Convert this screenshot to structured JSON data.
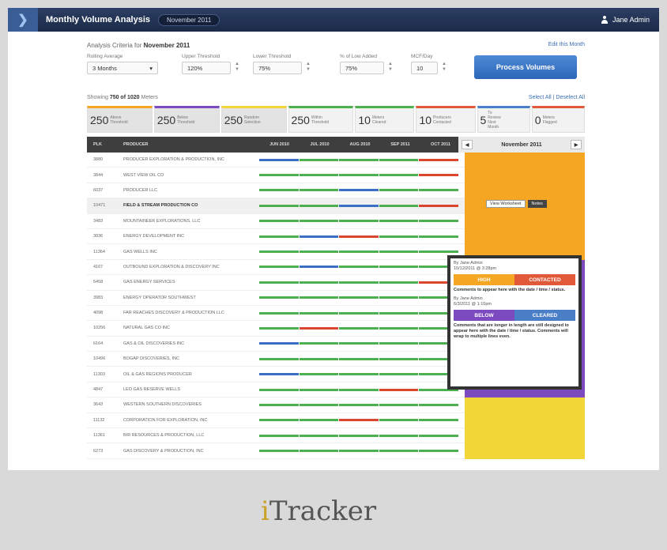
{
  "topbar": {
    "logo_glyph": "❯",
    "title": "Monthly Volume Analysis",
    "month_pill": "November 2011",
    "user": "Jane Admin"
  },
  "criteria": {
    "title_prefix": "Analysis Criteria for",
    "title_month": "November 2011",
    "edit_link": "Edit this Month",
    "fields": [
      {
        "label": "Rolling Average",
        "value": "3 Months"
      },
      {
        "label": "Upper Threshold",
        "value": "120%"
      },
      {
        "label": "Lower Threshold",
        "value": "75%"
      },
      {
        "label": "% of Low Added",
        "value": "75%"
      },
      {
        "label": "MCF/Day",
        "value": "10"
      }
    ],
    "process_label": "Process Volumes"
  },
  "summary": {
    "prefix": "Showing",
    "count": "750 of 1020",
    "suffix": "Meters",
    "select_all": "Select All",
    "deselect_all": "Deselect All"
  },
  "stats": [
    {
      "num": "250",
      "label": "Above Threshold",
      "color": "#f5a623"
    },
    {
      "num": "250",
      "label": "Below Threshold",
      "color": "#7b4bbf"
    },
    {
      "num": "250",
      "label": "Random Selection",
      "color": "#f2d536"
    },
    {
      "num": "250",
      "label": "Within Threshold",
      "color": "#4caf50"
    },
    {
      "num": "10",
      "label": "Meters Cleared",
      "color": "#4caf50"
    },
    {
      "num": "10",
      "label": "Producers Contacted",
      "color": "#e05a3a"
    },
    {
      "num": "5",
      "label": "To Review Next Month",
      "color": "#4a7fc8"
    },
    {
      "num": "0",
      "label": "Meters Flagged",
      "color": "#e05a3a"
    }
  ],
  "grid": {
    "headers": {
      "id": "PLK",
      "operator": "PRODUCER",
      "months": [
        "JUN 2010",
        "JUL 2010",
        "AUG 2010",
        "SEP 2011",
        "OCT 2011"
      ]
    },
    "nav_month": "November 2011",
    "rows": [
      {
        "id": "3880",
        "op": "PRODUCER EXPLORATION & PRODUCTION, INC",
        "bars": [
          "b",
          "g",
          "g",
          "g",
          "r"
        ],
        "status": "#f5a623"
      },
      {
        "id": "3844",
        "op": "WEST VIEW OIL CO",
        "bars": [
          "g",
          "g",
          "g",
          "g",
          "r"
        ],
        "status": "#f5a623"
      },
      {
        "id": "6037",
        "op": "PRODUCER LLC",
        "bars": [
          "g",
          "g",
          "b",
          "g",
          "g"
        ],
        "status": "#f5a623"
      },
      {
        "id": "10471",
        "op": "FIELD & STREAM PRODUCTION CO",
        "bars": [
          "g",
          "g",
          "b",
          "g",
          "r"
        ],
        "status": "#f5a623"
      },
      {
        "id": "3483",
        "op": "MOUNTAINEER EXPLORATIONS, LLC",
        "bars": [
          "g",
          "g",
          "g",
          "g",
          "g"
        ],
        "status": "#f5a623"
      },
      {
        "id": "3036",
        "op": "ENERGY DEVELOPMENT INC",
        "bars": [
          "g",
          "b",
          "r",
          "g",
          "g"
        ],
        "status": "#f5a623"
      },
      {
        "id": "11364",
        "op": "GAS WELLS INC",
        "bars": [
          "g",
          "g",
          "g",
          "g",
          "g"
        ],
        "status": "#f5a623"
      },
      {
        "id": "4167",
        "op": "OUTBOUND EXPLORATION & DISCOVERY INC",
        "bars": [
          "g",
          "b",
          "g",
          "g",
          "g"
        ],
        "status": "#7b4bbf"
      },
      {
        "id": "5458",
        "op": "GAS ENERGY SERVICES",
        "bars": [
          "g",
          "g",
          "g",
          "g",
          "r"
        ],
        "status": "#7b4bbf"
      },
      {
        "id": "3983",
        "op": "ENERGY OPERATOR SOUTHWEST",
        "bars": [
          "g",
          "g",
          "g",
          "g",
          "g"
        ],
        "status": "#7b4bbf"
      },
      {
        "id": "4098",
        "op": "FAR REACHES DISCOVERY & PRODUCTION LLC",
        "bars": [
          "g",
          "g",
          "g",
          "g",
          "g"
        ],
        "status": "#7b4bbf"
      },
      {
        "id": "10256",
        "op": "NATURAL GAS CO INC",
        "bars": [
          "g",
          "r",
          "g",
          "g",
          "g"
        ],
        "status": "#7b4bbf"
      },
      {
        "id": "6164",
        "op": "GAS & OIL DISCOVERIES INC",
        "bars": [
          "b",
          "g",
          "g",
          "g",
          "g"
        ],
        "status": "#7b4bbf"
      },
      {
        "id": "10496",
        "op": "BOGAP DISCOVERIES, INC",
        "bars": [
          "g",
          "g",
          "g",
          "g",
          "g"
        ],
        "status": "#7b4bbf"
      },
      {
        "id": "11303",
        "op": "OIL & GAS REGIONS PRODUCER",
        "bars": [
          "b",
          "g",
          "g",
          "g",
          "g"
        ],
        "status": "#7b4bbf"
      },
      {
        "id": "4847",
        "op": "LEO GAS RESERVE WELLS",
        "bars": [
          "g",
          "g",
          "g",
          "r",
          "g"
        ],
        "status": "#7b4bbf"
      },
      {
        "id": "3643",
        "op": "WESTERN SOUTHERN DISCOVERIES",
        "bars": [
          "g",
          "g",
          "g",
          "g",
          "g"
        ],
        "status": "#f2d536"
      },
      {
        "id": "11132",
        "op": "CORPORATION FOR EXPLORATION, INC",
        "bars": [
          "g",
          "g",
          "r",
          "g",
          "g"
        ],
        "status": "#f2d536"
      },
      {
        "id": "11361",
        "op": "BIR RESOURCES & PRODUCTION, LLC",
        "bars": [
          "g",
          "g",
          "g",
          "g",
          "g"
        ],
        "status": "#f2d536"
      },
      {
        "id": "6273",
        "op": "GAS DISCOVERY & PRODUCTION, INC",
        "bars": [
          "g",
          "g",
          "g",
          "g",
          "g"
        ],
        "status": "#f2d536"
      }
    ],
    "bar_colors": {
      "g": "#4caf50",
      "b": "#3a6fc4",
      "r": "#d9452f"
    }
  },
  "row_actions": {
    "worksheet": "View Worksheet",
    "notes": "Notes"
  },
  "popup": {
    "entry1_by": "By Jane Admin",
    "entry1_date": "10/12/2011 @ 3:28pm",
    "entry1_left": "HIGH",
    "entry1_right": "CONTACTED",
    "entry1_comment": "Comments to appear here with the date / time / status.",
    "entry2_by": "By Jane Admin",
    "entry2_date": "6/3/2011 @ 1:10pm",
    "entry2_left": "BELOW",
    "entry2_right": "CLEARED",
    "entry2_comment": "Comments that are longer in length are still designed to appear here with the date / time / status. Comments will wrap to multiple lines even."
  },
  "footer": {
    "brand_i": "i",
    "brand_rest": "Tracker"
  }
}
